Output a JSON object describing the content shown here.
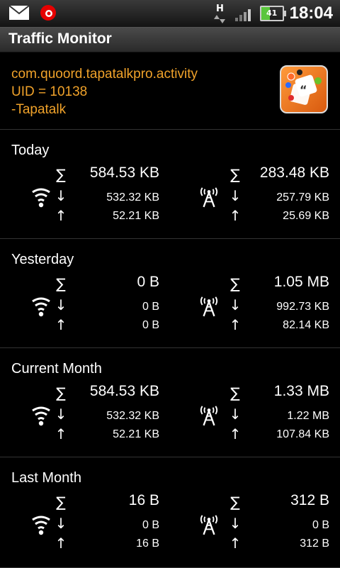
{
  "status_bar": {
    "clock": "18:04",
    "battery": "41",
    "network_letter": "H"
  },
  "title": "Traffic Monitor",
  "app": {
    "package": "com.quoord.tapatalkpro.activity",
    "uid": "UID = 10138",
    "name": "-Tapatalk"
  },
  "symbols": {
    "total": "∑",
    "down": "↓",
    "up": "↑"
  },
  "sections": [
    {
      "title": "Today",
      "wifi": {
        "total": "584.53 KB",
        "down": "532.32 KB",
        "up": "52.21 KB"
      },
      "mobile": {
        "total": "283.48 KB",
        "down": "257.79 KB",
        "up": "25.69 KB"
      }
    },
    {
      "title": "Yesterday",
      "wifi": {
        "total": "0 B",
        "down": "0 B",
        "up": "0 B"
      },
      "mobile": {
        "total": "1.05 MB",
        "down": "992.73 KB",
        "up": "82.14 KB"
      }
    },
    {
      "title": "Current Month",
      "wifi": {
        "total": "584.53 KB",
        "down": "532.32 KB",
        "up": "52.21 KB"
      },
      "mobile": {
        "total": "1.33 MB",
        "down": "1.22 MB",
        "up": "107.84 KB"
      }
    },
    {
      "title": "Last Month",
      "wifi": {
        "total": "16 B",
        "down": "0 B",
        "up": "16 B"
      },
      "mobile": {
        "total": "312 B",
        "down": "0 B",
        "up": "312 B"
      }
    }
  ]
}
